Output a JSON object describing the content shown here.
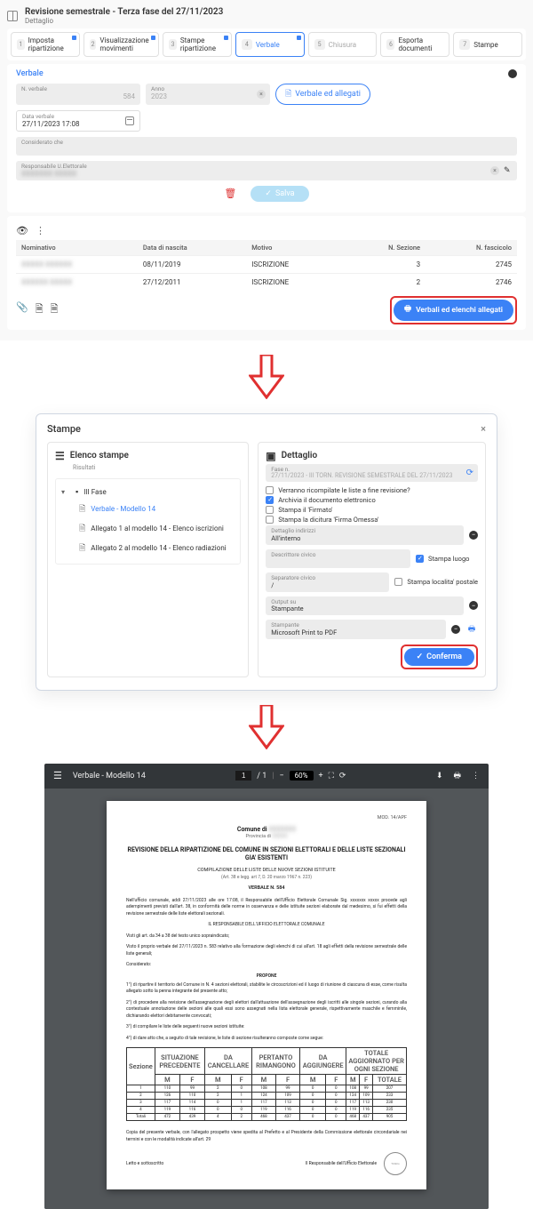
{
  "header": {
    "title": "Revisione semestrale - Terza fase del 27/11/2023",
    "subtitle": "Dettaglio"
  },
  "tabs": [
    {
      "n": "1",
      "label": "Imposta ripartizione",
      "sq": true
    },
    {
      "n": "2",
      "label": "Visualizzazione movimenti",
      "sq": true
    },
    {
      "n": "3",
      "label": "Stampe ripartizione",
      "sq": true
    },
    {
      "n": "4",
      "label": "Verbale",
      "active": true,
      "sq": true
    },
    {
      "n": "5",
      "label": "Chiusura",
      "dis": true
    },
    {
      "n": "6",
      "label": "Esporta documenti"
    },
    {
      "n": "7",
      "label": "Stampe"
    }
  ],
  "verbale": {
    "card_title": "Verbale",
    "num_label": "N. verbale",
    "num_val": "584",
    "anno_label": "Anno",
    "anno_val": "2023",
    "chip": "Verbale ed allegati",
    "date_label": "Data verbale",
    "date_val": "27/11/2023 17:08",
    "considerato": "Considerato che",
    "resp_label": "Responsabile U.Elettorale",
    "resp_val": "XXXXXXX XXXXX",
    "save": "Salva",
    "big_button": "Verbali ed elenchi allegati"
  },
  "grid": {
    "cols": [
      "Nominativo",
      "Data di nascita",
      "Motivo",
      "N. Sezione",
      "N. fascicolo"
    ],
    "rows": [
      {
        "c1": "XXXXX XXXXXX",
        "c2": "08/11/2019",
        "c3": "ISCRIZIONE",
        "c4": "3",
        "c5": "2745"
      },
      {
        "c1": "XXXXXX XXXXX",
        "c2": "27/12/2011",
        "c3": "ISCRIZIONE",
        "c4": "2",
        "c5": "2746"
      }
    ]
  },
  "stampe": {
    "title": "Stampe",
    "close": "×",
    "ltitle": "Elenco stampe",
    "lsub": "Risultati",
    "rtitle": "Dettaglio",
    "fase_label": "Fase n.",
    "fase_val": "27/11/2023 - III TORN. REVISIONE SEMESTRALE DEL 27/11/2023",
    "tree": {
      "root": "III Fase",
      "items": [
        {
          "label": "Verbale - Modello 14",
          "link": true
        },
        {
          "label": "Allegato 1 al modello 14 - Elenco iscrizioni"
        },
        {
          "label": "Allegato 2 al modello 14 - Elenco radiazioni"
        }
      ]
    },
    "checks": [
      {
        "label": "Verranno ricompilate le liste a fine revisione?",
        "ck": false
      },
      {
        "label": "Archivia il documento elettronico",
        "ck": true
      },
      {
        "label": "Stampa il 'Firmato'",
        "ck": false
      },
      {
        "label": "Stampa la dicitura 'Firma Omessa'",
        "ck": false
      }
    ],
    "f_det_label": "Dettaglio indirizzi",
    "f_det_val": "All'interno",
    "cb_luogo": "Stampa luogo",
    "cb_loc": "Stampa localita' postale",
    "desc_label": "Descrittore civico",
    "sep_label": "Separatore civico",
    "sep_val": "/",
    "out_label": "Output su",
    "out_val": "Stampante",
    "prn_label": "Stampante",
    "prn_val": "Microsoft Print to PDF",
    "confirm": "Conferma"
  },
  "pdf": {
    "name": "Verbale - Modello 14",
    "page": "1",
    "pages": "/ 1",
    "zoom": "60%",
    "mod": "MOD. 14/APF",
    "comune": "Comune di",
    "prov": "Provincia di",
    "title": "REVISIONE DELLA RIPARTIZIONE DEL COMUNE IN SEZIONI ELETTORALI E DELLE LISTE SEZIONALI GIA' ESISTENTI",
    "sub": "COMPILAZIONE DELLE LISTE DELLE NUOVE SEZIONI ISTITUITE",
    "sub2": "(Art. 38 e legg. art 7, D. 20 marzo 1967 n. 223)",
    "verbn": "VERBALE N. 584",
    "para1": "Nell'ufficio comunale, addì 27/11/2023 alle ore 17:08, il Responsabile dell'Ufficio Elettorale Comunale Sig. xxxxxxx xxxxx procede agli adempimenti previsti dall'art. 38, in conformità delle norme in osservanza e delle istituite sezioni elaborate dal medesimo, si fui effetti della revisione semestrale delle liste elettorali sezionali.",
    "resp_line": "IL RESPONSABILE DELL'UFFICIO ELETTORALE COMUNALE",
    "para2": "Visti gli art. da 34 a 38 del testo unico sopraindicato;",
    "para3": "Visto il proprio verbale del 27/11/2023 n. 583 relativo alla formazione degli elenchi di cui all'art. 18 agli effetti della revisione semestrale delle liste generali;",
    "cons": "Considerato:",
    "propone": "PROPONE",
    "para4": "1°) di ripartire il territorio del Comune in N. 4 sezioni elettorali, stabilite le circoscrizioni ed il luogo di riunione di ciascuna di esse, come risulta allegato sotto la penna integrante del presente atto;",
    "para5": "2°) di procedere alla revisione dell'assegnazione degli elettori dall'attuazione dell'assegnazione degli iscritti alle singole sezioni, curando alla contestuale annotazione delle sezioni alle quali essi sono assegnati nella lista elettorale generale, rispettivamente maschile e femminile, dichiarando elettori debitamente convocati;",
    "para6": "3°) di compilare le liste delle seguenti nuove sezioni istituite:",
    "para7": "4°) di dare atto che, a seguito di tale revisione, le liste di sezione risulteranno composte come segue:",
    "note": "Copia del presente verbale, con l'allegato prospetto viene spedita al Prefetto e al Presidente della Commissione elettorale circondariale nei termini e con le modalità indicate all'art. 29",
    "sign_l": "Letto e sottoscritto",
    "sign_r": "Il Responsabile dell'Ufficio Elettorale",
    "stamp": "Timbro",
    "thead": {
      "g0": "Sezione",
      "g1": "SITUAZIONE PRECEDENTE",
      "g2": "DA CANCELLARE",
      "g3": "PERTANTO RIMANGONO",
      "g4": "DA AGGIUNGERE",
      "g5": "TOTALE AGGIORNATO PER OGNI SEZIONE",
      "m": "M",
      "f": "F",
      "t": "TOTALE"
    },
    "trows": [
      {
        "s": "1",
        "p": [
          "110",
          "99"
        ],
        "c": [
          "2",
          "0"
        ],
        "r": [
          "108",
          "99"
        ],
        "a": [
          "0",
          "0"
        ],
        "t": [
          "108",
          "99",
          "207"
        ]
      },
      {
        "s": "2",
        "p": [
          "126",
          "110"
        ],
        "c": [
          "2",
          "1"
        ],
        "r": [
          "124",
          "109"
        ],
        "a": [
          "0",
          "0"
        ],
        "t": [
          "124",
          "109",
          "233"
        ]
      },
      {
        "s": "3",
        "p": [
          "117",
          "114"
        ],
        "c": [
          "0",
          "1"
        ],
        "r": [
          "117",
          "113"
        ],
        "a": [
          "0",
          "0"
        ],
        "t": [
          "117",
          "113",
          "230"
        ]
      },
      {
        "s": "4",
        "p": [
          "119",
          "116"
        ],
        "c": [
          "0",
          "0"
        ],
        "r": [
          "119",
          "116"
        ],
        "a": [
          "0",
          "0"
        ],
        "t": [
          "119",
          "116",
          "235"
        ]
      },
      {
        "s": "Totali",
        "p": [
          "472",
          "439"
        ],
        "c": [
          "4",
          "2"
        ],
        "r": [
          "468",
          "437"
        ],
        "a": [
          "0",
          "0"
        ],
        "t": [
          "468",
          "437",
          "905"
        ]
      }
    ]
  }
}
